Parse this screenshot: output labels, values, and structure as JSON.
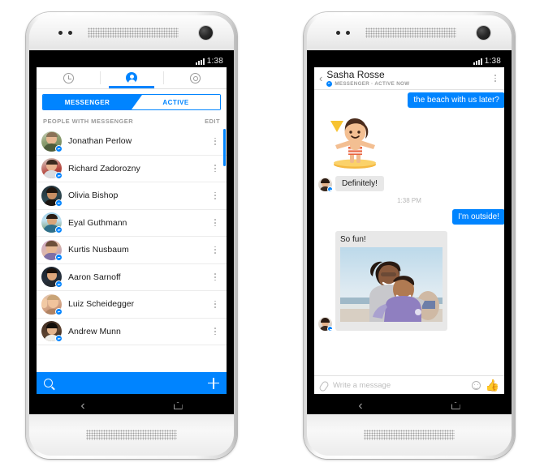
{
  "page": {
    "background": "#ffffff",
    "accent": "#0084ff"
  },
  "phones": {
    "left": {
      "name": "messenger-contacts-phone",
      "status_bar": {
        "time": "1:38",
        "signal_icon": "signal-bars-icon"
      },
      "tabs": [
        {
          "id": "recent",
          "icon": "clock-icon",
          "active": false
        },
        {
          "id": "people",
          "icon": "person-icon",
          "active": true
        },
        {
          "id": "settings",
          "icon": "gear-icon",
          "active": false
        }
      ],
      "segmented_control": {
        "options": [
          {
            "label": "MESSENGER",
            "selected": true
          },
          {
            "label": "ACTIVE",
            "selected": false
          }
        ]
      },
      "list_header": {
        "title": "PEOPLE WITH MESSENGER",
        "action": "EDIT"
      },
      "contacts": [
        {
          "name": "Jonathan Perlow",
          "badge": "messenger-badge",
          "menu": "overflow-icon"
        },
        {
          "name": "Richard Zadorozny",
          "badge": "messenger-badge",
          "menu": "overflow-icon"
        },
        {
          "name": "Olivia Bishop",
          "badge": "messenger-badge",
          "menu": "overflow-icon"
        },
        {
          "name": "Eyal Guthmann",
          "badge": "messenger-badge",
          "menu": "overflow-icon"
        },
        {
          "name": "Kurtis Nusbaum",
          "badge": "messenger-badge",
          "menu": "overflow-icon"
        },
        {
          "name": "Aaron Sarnoff",
          "badge": "messenger-badge",
          "menu": "overflow-icon"
        },
        {
          "name": "Luiz Scheidegger",
          "badge": "messenger-badge",
          "menu": "overflow-icon"
        },
        {
          "name": "Andrew Munn",
          "badge": "messenger-badge",
          "menu": "overflow-icon"
        }
      ],
      "bottom_bar": {
        "search_icon": "search-icon",
        "add_icon": "plus-icon",
        "color": "#0084ff"
      },
      "nav_bar": {
        "back": "back-icon",
        "home": "home-icon"
      }
    },
    "right": {
      "name": "messenger-thread-phone",
      "status_bar": {
        "time": "1:38",
        "signal_icon": "signal-bars-icon"
      },
      "header": {
        "back": "back-chevron-icon",
        "title": "Sasha Rosse",
        "subtitle": "MESSENGER · ACTIVE NOW",
        "badge": "messenger-badge",
        "menu": "overflow-icon"
      },
      "messages": [
        {
          "type": "text",
          "side": "out",
          "text": "the beach with us later?"
        },
        {
          "type": "sticker",
          "side": "in",
          "sticker": "surfer-sticker"
        },
        {
          "type": "text",
          "side": "in",
          "text": "Definitely!",
          "avatar": "sasha-avatar"
        },
        {
          "type": "timestamp",
          "text": "1:38 PM"
        },
        {
          "type": "text",
          "side": "out",
          "text": "I'm outside!"
        },
        {
          "type": "photo",
          "side": "in",
          "caption": "So fun!",
          "photo": "beach-couple-photo"
        }
      ],
      "composer": {
        "attach_icon": "paperclip-icon",
        "placeholder": "Write a message",
        "emoji_icon": "smiley-icon",
        "like_icon": "thumbs-up-icon"
      },
      "nav_bar": {
        "back": "back-icon",
        "home": "home-icon"
      }
    }
  }
}
